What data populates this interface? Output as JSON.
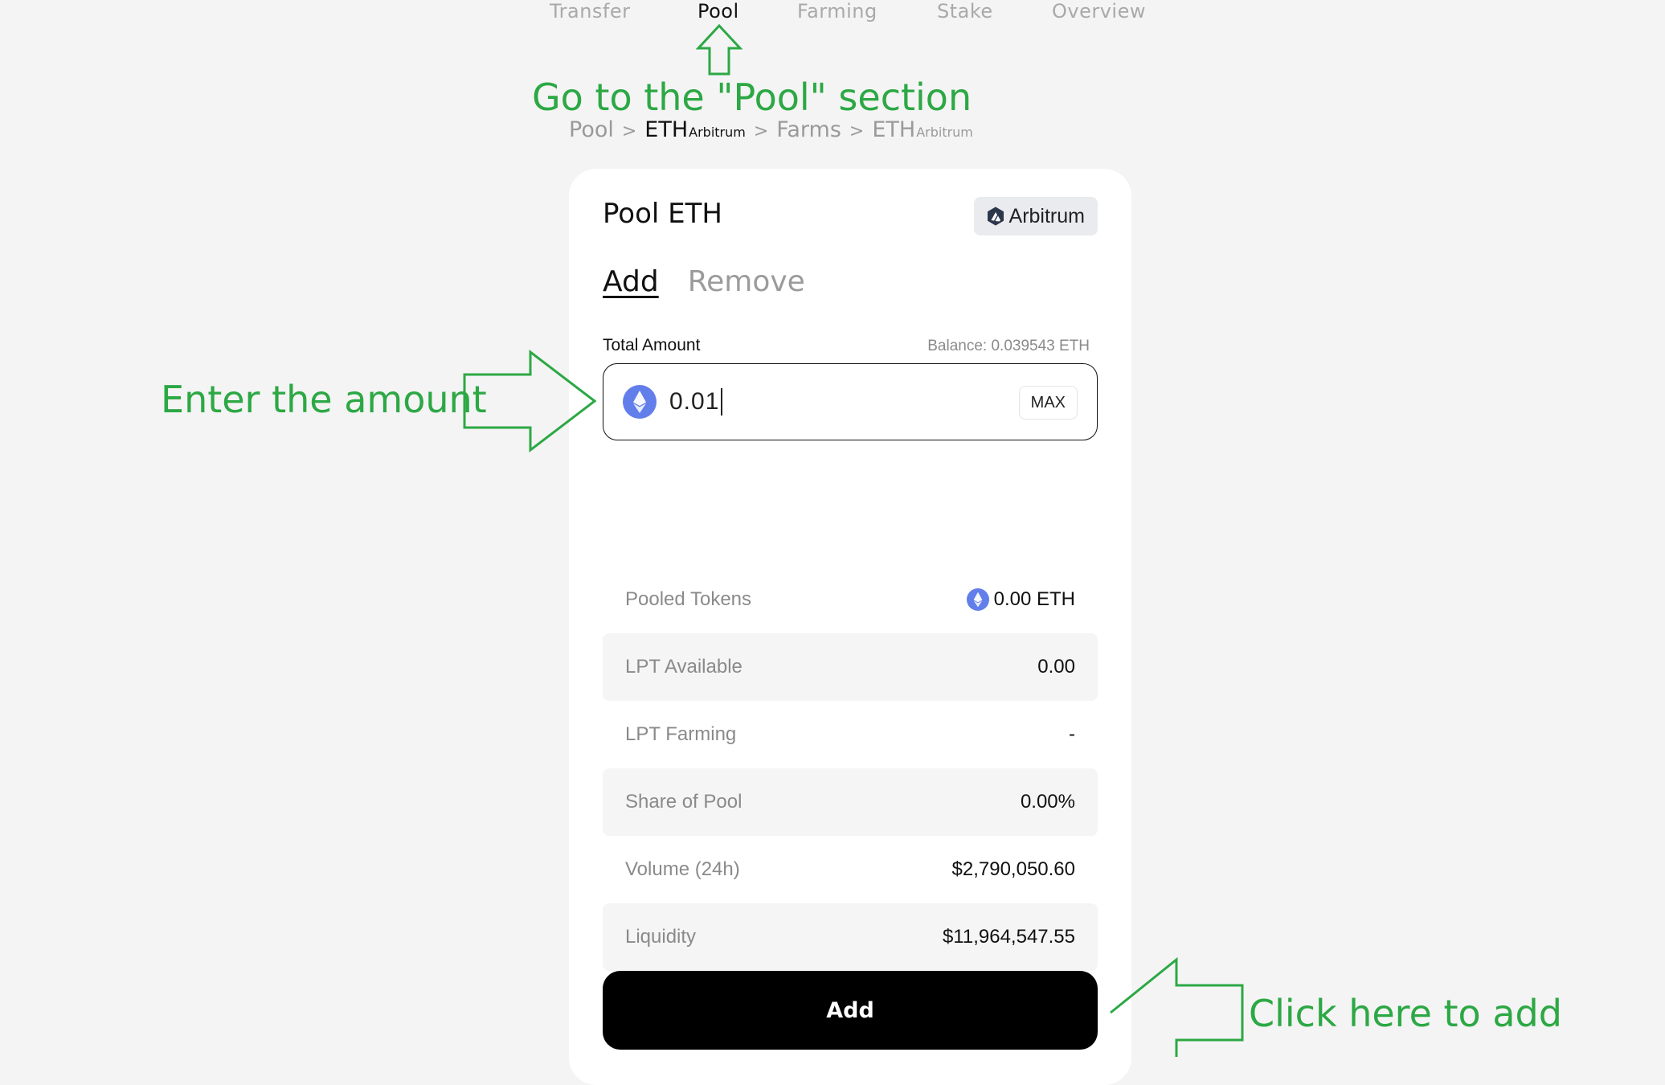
{
  "nav": {
    "items": [
      {
        "label": "Transfer",
        "active": false
      },
      {
        "label": "Pool",
        "active": true
      },
      {
        "label": "Farming",
        "active": false
      },
      {
        "label": "Stake",
        "active": false
      },
      {
        "label": "Overview",
        "active": false
      }
    ]
  },
  "breadcrumb": {
    "items": [
      {
        "label": "Pool",
        "sub": ""
      },
      {
        "label": "ETH",
        "sub": "Arbitrum"
      },
      {
        "label": "Farms",
        "sub": ""
      },
      {
        "label": "ETH",
        "sub": "Arbitrum"
      }
    ],
    "separator": ">"
  },
  "card": {
    "title": "Pool ETH",
    "network": "Arbitrum",
    "tabs": [
      {
        "label": "Add",
        "active": true
      },
      {
        "label": "Remove",
        "active": false
      }
    ],
    "amount_label": "Total Amount",
    "balance": "Balance: 0.039543 ETH",
    "amount_value": "0.01",
    "max_label": "MAX",
    "stats": [
      {
        "label": "Pooled Tokens",
        "value": "0.00 ETH"
      },
      {
        "label": "LPT Available",
        "value": "0.00"
      },
      {
        "label": "LPT Farming",
        "value": "-"
      },
      {
        "label": "Share of Pool",
        "value": "0.00%"
      },
      {
        "label": "Volume (24h)",
        "value": "$2,790,050.60"
      },
      {
        "label": "Liquidity",
        "value": "$11,964,547.55"
      }
    ],
    "add_button": "Add"
  },
  "annotations": {
    "pool": "Go to the \"Pool\" section",
    "amount": "Enter the amount",
    "add": "Click here to add"
  },
  "colors": {
    "annotation": "#2ca844",
    "eth_icon": "#627eea",
    "button": "#000000"
  },
  "icons": [
    "ethereum-icon",
    "arbitrum-icon",
    "arrow-up-annotation",
    "arrow-right-annotation",
    "arrow-left-annotation"
  ]
}
